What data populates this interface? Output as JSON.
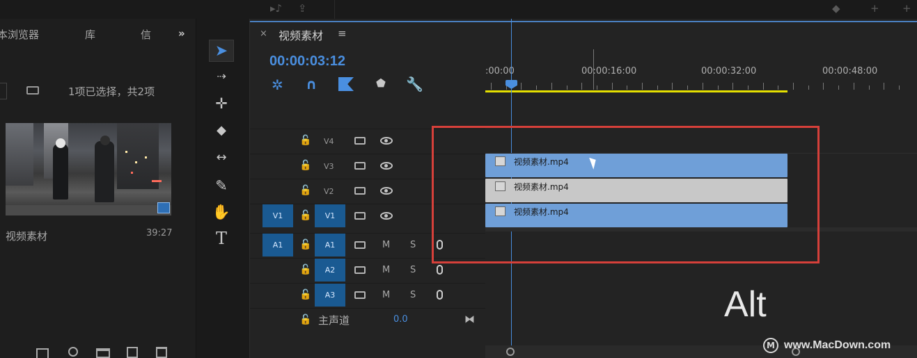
{
  "project_panel": {
    "tabs": [
      "本浏览器",
      "库",
      "信"
    ],
    "more": "»",
    "status": "1项已选择，共2项",
    "clip_name": "视频素材",
    "clip_duration": "39:27"
  },
  "timeline": {
    "close": "×",
    "sequence_name": "视频素材",
    "menu": "≡",
    "timecode": "00:00:03:12",
    "ruler": [
      ":00:00",
      "00:00:16:00",
      "00:00:32:00",
      "00:00:48:00"
    ],
    "tracks": {
      "video": [
        {
          "label": "V4",
          "source": ""
        },
        {
          "label": "V3",
          "source": ""
        },
        {
          "label": "V2",
          "source": ""
        },
        {
          "label": "V1",
          "source": "V1"
        }
      ],
      "audio": [
        {
          "label": "A1",
          "source": "A1",
          "m": "M",
          "s": "S"
        },
        {
          "label": "A2",
          "source": "",
          "m": "M",
          "s": "S"
        },
        {
          "label": "A3",
          "source": "",
          "m": "M",
          "s": "S"
        }
      ]
    },
    "master": {
      "label": "主声道",
      "value": "0.0"
    },
    "clips": [
      {
        "track": "V3",
        "name": "视频素材.mp4",
        "color": "#6f9fd8"
      },
      {
        "track": "V2",
        "name": "视频素材.mp4",
        "color": "#c8c8c8"
      },
      {
        "track": "V1",
        "name": "视频素材.mp4",
        "color": "#6f9fd8"
      }
    ]
  },
  "overlay": {
    "key_hint": "Alt",
    "watermark": "www.MacDown.com"
  },
  "colors": {
    "accent_blue": "#4a8fe0",
    "track_target": "#1a5a92",
    "highlight_box": "#d6403a",
    "work_area": "#e5e000"
  }
}
